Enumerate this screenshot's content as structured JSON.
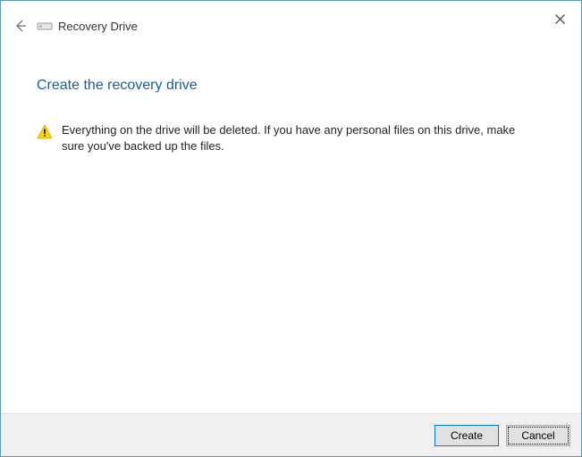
{
  "header": {
    "wizard_title": "Recovery Drive"
  },
  "page": {
    "heading": "Create the recovery drive",
    "warning_text": "Everything on the drive will be deleted. If you have any personal files on this drive, make sure you've backed up the files."
  },
  "footer": {
    "create_label": "Create",
    "cancel_label": "Cancel"
  }
}
